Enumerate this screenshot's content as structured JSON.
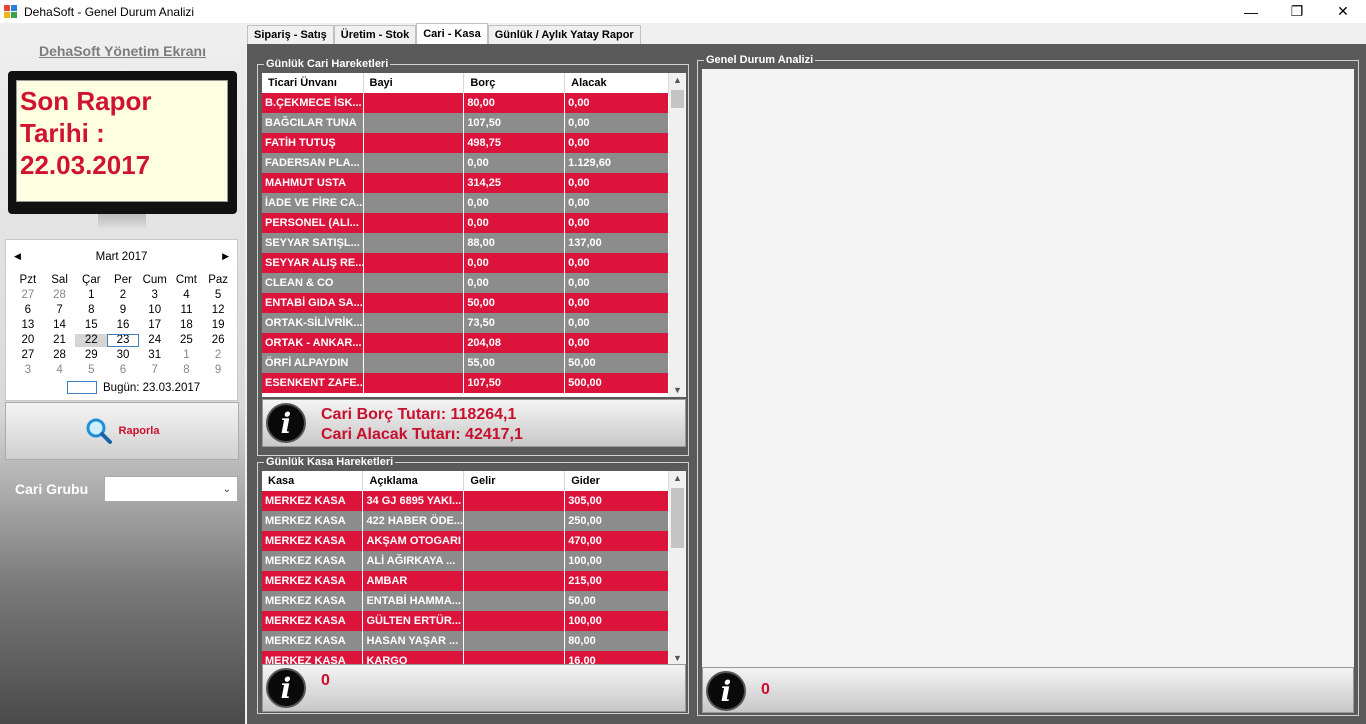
{
  "window": {
    "title": "DehaSoft - Genel Durum Analizi",
    "min": "—",
    "restore": "❐",
    "close": "✕"
  },
  "left": {
    "brand": "DehaSoft Yönetim Ekranı",
    "report_label_1": "Son Rapor",
    "report_label_2": "Tarihi :",
    "report_date": "22.03.2017",
    "calendar": {
      "month": "Mart 2017",
      "prev": "◀",
      "next": "▶",
      "weekdays": [
        "Pzt",
        "Sal",
        "Çar",
        "Per",
        "Cum",
        "Cmt",
        "Paz"
      ],
      "days": [
        [
          "27",
          "28",
          "1",
          "2",
          "3",
          "4",
          "5"
        ],
        [
          "6",
          "7",
          "8",
          "9",
          "10",
          "11",
          "12"
        ],
        [
          "13",
          "14",
          "15",
          "16",
          "17",
          "18",
          "19"
        ],
        [
          "20",
          "21",
          "22",
          "23",
          "24",
          "25",
          "26"
        ],
        [
          "27",
          "28",
          "29",
          "30",
          "31",
          "1",
          "2"
        ],
        [
          "3",
          "4",
          "5",
          "6",
          "7",
          "8",
          "9"
        ]
      ],
      "today_text": "Bugün: 23.03.2017"
    },
    "report_button": "Raporla",
    "group_label": "Cari Grubu",
    "group_value": ""
  },
  "tabs": [
    "Sipariş - Satış",
    "Üretim - Stok",
    "Cari - Kasa",
    "Günlük / Aylık Yatay Rapor"
  ],
  "cari": {
    "legend": "Günlük Cari Hareketleri",
    "columns": [
      "Ticari Ünvanı",
      "Bayi",
      "Borç",
      "Alacak"
    ],
    "rows": [
      [
        "B.ÇEKMECE İSK...",
        "",
        "80,00",
        "0,00"
      ],
      [
        "BAĞCILAR TUNA",
        "",
        "107,50",
        "0,00"
      ],
      [
        "FATİH TUTUŞ",
        "",
        "498,75",
        "0,00"
      ],
      [
        "FADERSAN PLA...",
        "",
        "0,00",
        "1.129,60"
      ],
      [
        "MAHMUT USTA",
        "",
        "314,25",
        "0,00"
      ],
      [
        "İADE VE FİRE CA...",
        "",
        "0,00",
        "0,00"
      ],
      [
        "PERSONEL (ALI...",
        "",
        "0,00",
        "0,00"
      ],
      [
        "SEYYAR SATIŞL...",
        "",
        "88,00",
        "137,00"
      ],
      [
        "SEYYAR ALIŞ RE...",
        "",
        "0,00",
        "0,00"
      ],
      [
        "CLEAN & CO",
        "",
        "0,00",
        "0,00"
      ],
      [
        "ENTABİ GIDA SA...",
        "",
        "50,00",
        "0,00"
      ],
      [
        "ORTAK-SİLİVRİK...",
        "",
        "73,50",
        "0,00"
      ],
      [
        "ORTAK - ANKAR...",
        "",
        "204,08",
        "0,00"
      ],
      [
        "ÖRFİ ALPAYDIN",
        "",
        "55,00",
        "50,00"
      ],
      [
        "ESENKENT ZAFE...",
        "",
        "107,50",
        "500,00"
      ]
    ],
    "borc_total": "Cari Borç Tutarı: 118264,1",
    "alacak_total": "Cari Alacak Tutarı: 42417,1"
  },
  "kasa": {
    "legend": "Günlük Kasa Hareketleri",
    "columns": [
      "Kasa",
      "Açıklama",
      "Gelir",
      "Gider"
    ],
    "rows": [
      [
        "MERKEZ KASA",
        "34 GJ 6895 YAKI...",
        "",
        "305,00"
      ],
      [
        "MERKEZ KASA",
        "422 HABER ÖDE...",
        "",
        "250,00"
      ],
      [
        "MERKEZ KASA",
        "AKŞAM OTOGARI",
        "",
        "470,00"
      ],
      [
        "MERKEZ KASA",
        "ALİ AĞIRKAYA ...",
        "",
        "100,00"
      ],
      [
        "MERKEZ KASA",
        "AMBAR",
        "",
        "215,00"
      ],
      [
        "MERKEZ KASA",
        "ENTABİ HAMMA...",
        "",
        "50,00"
      ],
      [
        "MERKEZ KASA",
        "GÜLTEN ERTÜR...",
        "",
        "100,00"
      ],
      [
        "MERKEZ KASA",
        "HASAN YAŞAR ...",
        "",
        "80,00"
      ],
      [
        "MERKEZ KASA",
        "KARGO",
        "",
        "16,00"
      ]
    ],
    "total": "0"
  },
  "analiz": {
    "legend": "Genel Durum Analizi",
    "total": "0"
  },
  "info_glyph": "i",
  "colors": {
    "red": "#dc143c",
    "gray": "#8c8c8c",
    "accent": "#c8102e"
  }
}
